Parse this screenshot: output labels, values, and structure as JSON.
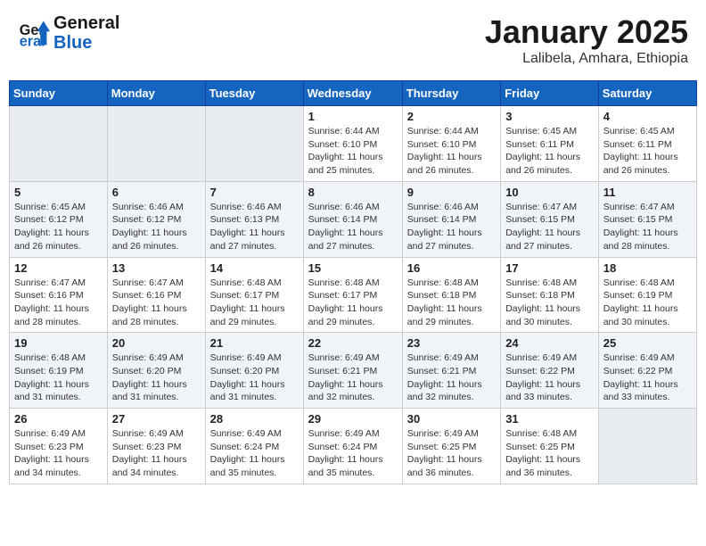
{
  "header": {
    "logo_line1": "General",
    "logo_line2": "Blue",
    "month": "January 2025",
    "location": "Lalibela, Amhara, Ethiopia"
  },
  "weekdays": [
    "Sunday",
    "Monday",
    "Tuesday",
    "Wednesday",
    "Thursday",
    "Friday",
    "Saturday"
  ],
  "weeks": [
    [
      {
        "day": "",
        "info": ""
      },
      {
        "day": "",
        "info": ""
      },
      {
        "day": "",
        "info": ""
      },
      {
        "day": "1",
        "info": "Sunrise: 6:44 AM\nSunset: 6:10 PM\nDaylight: 11 hours and 25 minutes."
      },
      {
        "day": "2",
        "info": "Sunrise: 6:44 AM\nSunset: 6:10 PM\nDaylight: 11 hours and 26 minutes."
      },
      {
        "day": "3",
        "info": "Sunrise: 6:45 AM\nSunset: 6:11 PM\nDaylight: 11 hours and 26 minutes."
      },
      {
        "day": "4",
        "info": "Sunrise: 6:45 AM\nSunset: 6:11 PM\nDaylight: 11 hours and 26 minutes."
      }
    ],
    [
      {
        "day": "5",
        "info": "Sunrise: 6:45 AM\nSunset: 6:12 PM\nDaylight: 11 hours and 26 minutes."
      },
      {
        "day": "6",
        "info": "Sunrise: 6:46 AM\nSunset: 6:12 PM\nDaylight: 11 hours and 26 minutes."
      },
      {
        "day": "7",
        "info": "Sunrise: 6:46 AM\nSunset: 6:13 PM\nDaylight: 11 hours and 27 minutes."
      },
      {
        "day": "8",
        "info": "Sunrise: 6:46 AM\nSunset: 6:14 PM\nDaylight: 11 hours and 27 minutes."
      },
      {
        "day": "9",
        "info": "Sunrise: 6:46 AM\nSunset: 6:14 PM\nDaylight: 11 hours and 27 minutes."
      },
      {
        "day": "10",
        "info": "Sunrise: 6:47 AM\nSunset: 6:15 PM\nDaylight: 11 hours and 27 minutes."
      },
      {
        "day": "11",
        "info": "Sunrise: 6:47 AM\nSunset: 6:15 PM\nDaylight: 11 hours and 28 minutes."
      }
    ],
    [
      {
        "day": "12",
        "info": "Sunrise: 6:47 AM\nSunset: 6:16 PM\nDaylight: 11 hours and 28 minutes."
      },
      {
        "day": "13",
        "info": "Sunrise: 6:47 AM\nSunset: 6:16 PM\nDaylight: 11 hours and 28 minutes."
      },
      {
        "day": "14",
        "info": "Sunrise: 6:48 AM\nSunset: 6:17 PM\nDaylight: 11 hours and 29 minutes."
      },
      {
        "day": "15",
        "info": "Sunrise: 6:48 AM\nSunset: 6:17 PM\nDaylight: 11 hours and 29 minutes."
      },
      {
        "day": "16",
        "info": "Sunrise: 6:48 AM\nSunset: 6:18 PM\nDaylight: 11 hours and 29 minutes."
      },
      {
        "day": "17",
        "info": "Sunrise: 6:48 AM\nSunset: 6:18 PM\nDaylight: 11 hours and 30 minutes."
      },
      {
        "day": "18",
        "info": "Sunrise: 6:48 AM\nSunset: 6:19 PM\nDaylight: 11 hours and 30 minutes."
      }
    ],
    [
      {
        "day": "19",
        "info": "Sunrise: 6:48 AM\nSunset: 6:19 PM\nDaylight: 11 hours and 31 minutes."
      },
      {
        "day": "20",
        "info": "Sunrise: 6:49 AM\nSunset: 6:20 PM\nDaylight: 11 hours and 31 minutes."
      },
      {
        "day": "21",
        "info": "Sunrise: 6:49 AM\nSunset: 6:20 PM\nDaylight: 11 hours and 31 minutes."
      },
      {
        "day": "22",
        "info": "Sunrise: 6:49 AM\nSunset: 6:21 PM\nDaylight: 11 hours and 32 minutes."
      },
      {
        "day": "23",
        "info": "Sunrise: 6:49 AM\nSunset: 6:21 PM\nDaylight: 11 hours and 32 minutes."
      },
      {
        "day": "24",
        "info": "Sunrise: 6:49 AM\nSunset: 6:22 PM\nDaylight: 11 hours and 33 minutes."
      },
      {
        "day": "25",
        "info": "Sunrise: 6:49 AM\nSunset: 6:22 PM\nDaylight: 11 hours and 33 minutes."
      }
    ],
    [
      {
        "day": "26",
        "info": "Sunrise: 6:49 AM\nSunset: 6:23 PM\nDaylight: 11 hours and 34 minutes."
      },
      {
        "day": "27",
        "info": "Sunrise: 6:49 AM\nSunset: 6:23 PM\nDaylight: 11 hours and 34 minutes."
      },
      {
        "day": "28",
        "info": "Sunrise: 6:49 AM\nSunset: 6:24 PM\nDaylight: 11 hours and 35 minutes."
      },
      {
        "day": "29",
        "info": "Sunrise: 6:49 AM\nSunset: 6:24 PM\nDaylight: 11 hours and 35 minutes."
      },
      {
        "day": "30",
        "info": "Sunrise: 6:49 AM\nSunset: 6:25 PM\nDaylight: 11 hours and 36 minutes."
      },
      {
        "day": "31",
        "info": "Sunrise: 6:48 AM\nSunset: 6:25 PM\nDaylight: 11 hours and 36 minutes."
      },
      {
        "day": "",
        "info": ""
      }
    ]
  ]
}
